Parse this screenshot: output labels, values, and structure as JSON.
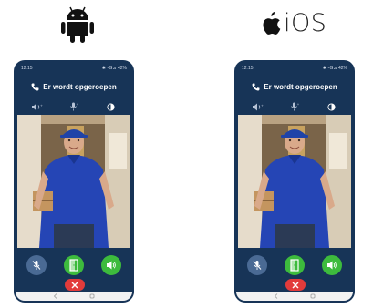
{
  "platforms": {
    "android": {
      "icon": "android-robot-icon"
    },
    "ios": {
      "icon": "apple-logo-icon",
      "label": "iOS"
    }
  },
  "phones": [
    {
      "platform": "android",
      "status": {
        "time": "12:15",
        "right": "✱ ⁴G⊿ 42%"
      },
      "header_text": "Er wordt opgeroepen",
      "controls": [
        "volume-icon",
        "microphone-icon",
        "brightness-icon"
      ],
      "actions": [
        "mute-microphone-button",
        "open-door-button",
        "speaker-button",
        "hang-up-button"
      ]
    },
    {
      "platform": "ios",
      "status": {
        "time": "12:15",
        "right": "✱ ⁴G⊿ 42%"
      },
      "header_text": "Er wordt opgeroepen",
      "controls": [
        "volume-icon",
        "microphone-icon",
        "brightness-icon"
      ],
      "actions": [
        "mute-microphone-button",
        "open-door-button",
        "speaker-button",
        "hang-up-button"
      ]
    }
  ],
  "colors": {
    "frame": "#173457",
    "accept_green": "#3dbb3d",
    "hangup_red": "#e23b3b",
    "mute_blue": "#4a6a94"
  }
}
